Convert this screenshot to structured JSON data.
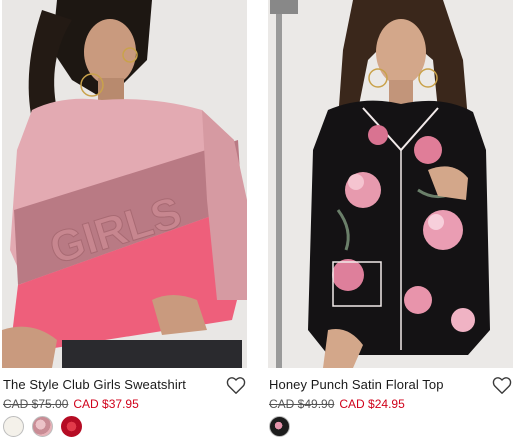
{
  "products": [
    {
      "name": "The Style Club Girls Sweatshirt",
      "original_price": "CAD $75.00",
      "sale_price": "CAD $37.95",
      "image_text": "GIRLS",
      "wishlist_icon": "heart-outline-icon",
      "swatches": [
        {
          "color_name": "cream",
          "color": "#f4f1ea"
        },
        {
          "color_name": "pink-pattern",
          "color": "#d9a7ae"
        },
        {
          "color_name": "red-pattern",
          "color": "#c8102e"
        }
      ]
    },
    {
      "name": "Honey Punch Satin Floral Top",
      "original_price": "CAD $49.90",
      "sale_price": "CAD $24.95",
      "wishlist_icon": "heart-outline-icon",
      "swatches": [
        {
          "color_name": "black-floral",
          "color": "#1c1c1c"
        }
      ]
    }
  ],
  "colors": {
    "sale": "#d0021b",
    "text": "#1a1a1a",
    "strikethrough": "#555555"
  }
}
